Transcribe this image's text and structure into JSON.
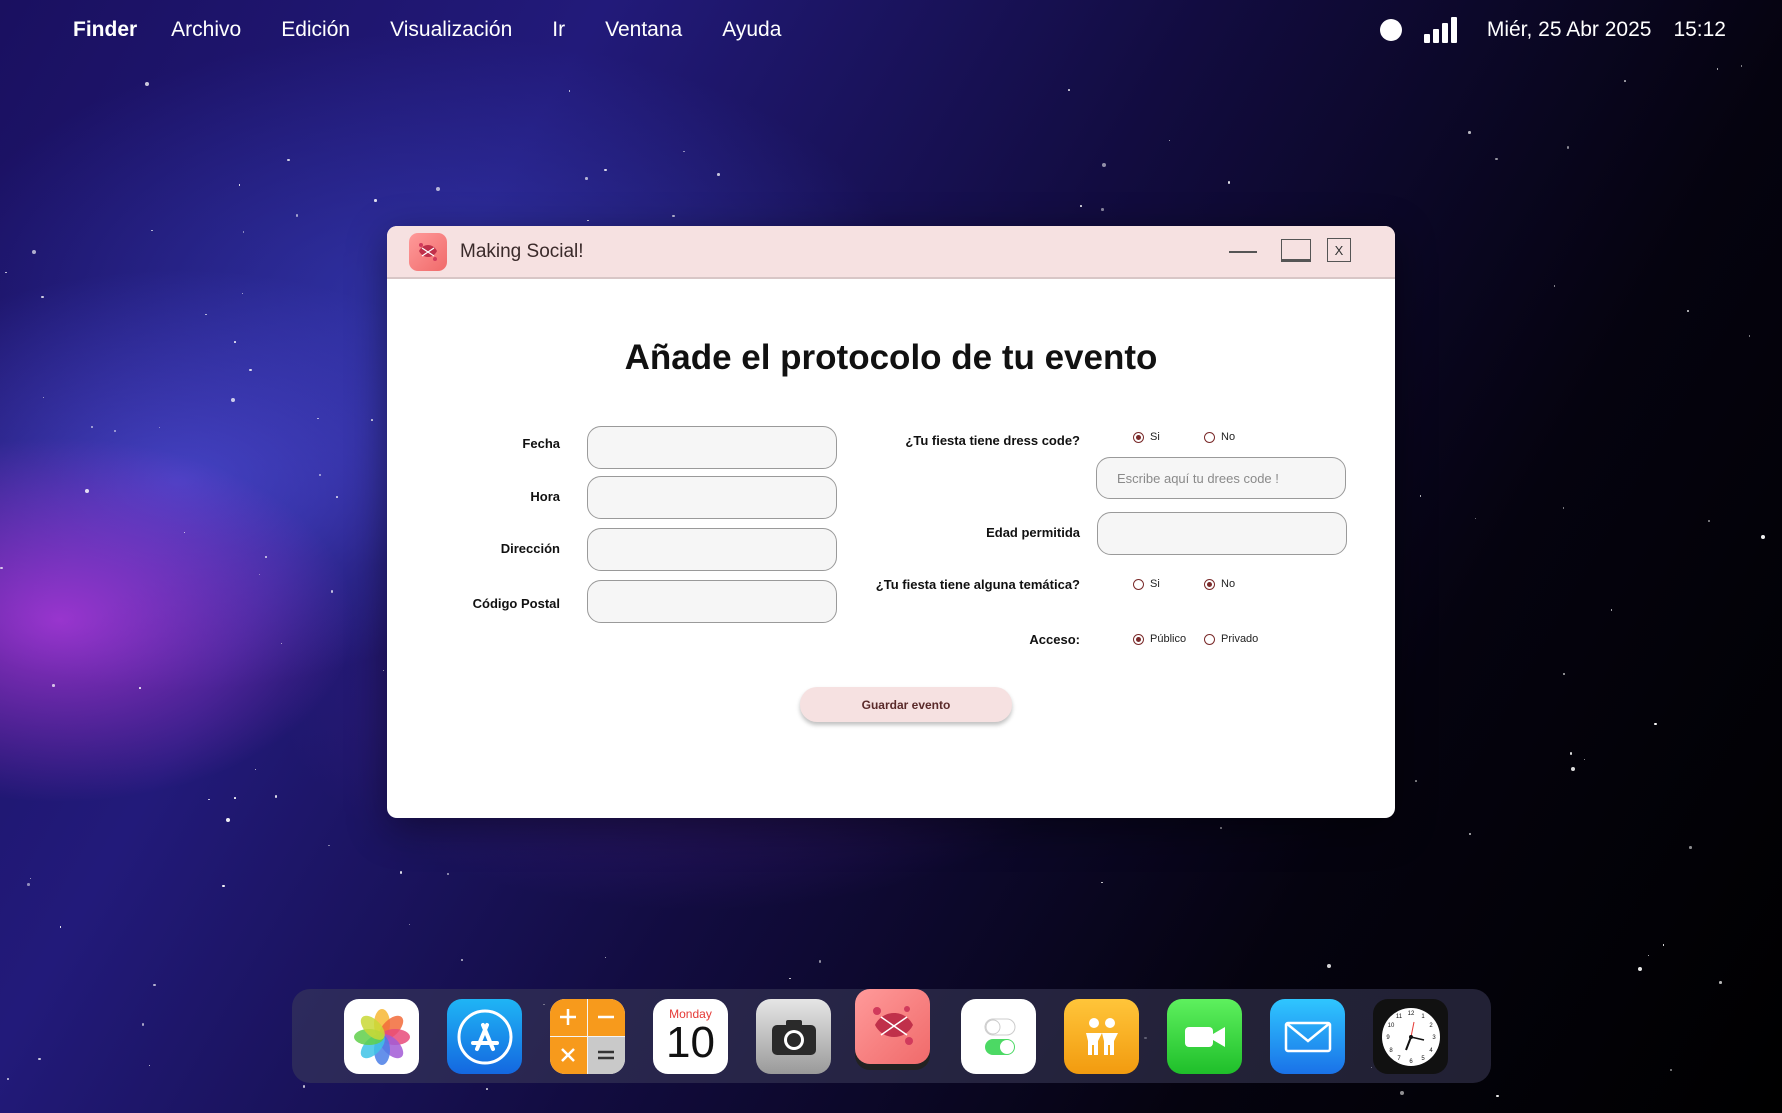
{
  "menubar": {
    "app_name": "Finder",
    "items": [
      "Archivo",
      "Edición",
      "Visualización",
      "Ir",
      "Ventana",
      "Ayuda"
    ],
    "date": "Miér, 25 Abr 2025",
    "time": "15:12"
  },
  "window": {
    "title": "Making Social!",
    "close_label": "X"
  },
  "form": {
    "heading": "Añade el protocolo de tu evento",
    "fecha_label": "Fecha",
    "hora_label": "Hora",
    "direccion_label": "Dirección",
    "codigo_postal_label": "Código Postal",
    "dress_code_question": "¿Tu fiesta tiene dress code?",
    "dress_code_si": "Si",
    "dress_code_no": "No",
    "dress_code_placeholder": "Escribe aquí tu drees code !",
    "edad_label": "Edad permitida",
    "tematica_question": "¿Tu fiesta tiene alguna temática?",
    "tematica_si": "Si",
    "tematica_no": "No",
    "acceso_label": "Acceso:",
    "acceso_publico": "Público",
    "acceso_privado": "Privado",
    "save_label": "Guardar evento",
    "selected": {
      "dress_code": "Si",
      "tematica": "No",
      "acceso": "Público"
    }
  },
  "dock": {
    "calendar_day_name": "Monday",
    "calendar_day_number": "10",
    "apps": [
      "photos-icon",
      "app-store-icon",
      "calculator-icon",
      "calendar-icon",
      "camera-icon",
      "making-social-icon",
      "settings-toggle-icon",
      "find-my-friends-icon",
      "facetime-icon",
      "mail-icon",
      "clock-icon"
    ]
  },
  "colors": {
    "titlebar": "#f6e1e1",
    "accent": "#7a2a2a",
    "app_icon": "#f06a6a"
  }
}
